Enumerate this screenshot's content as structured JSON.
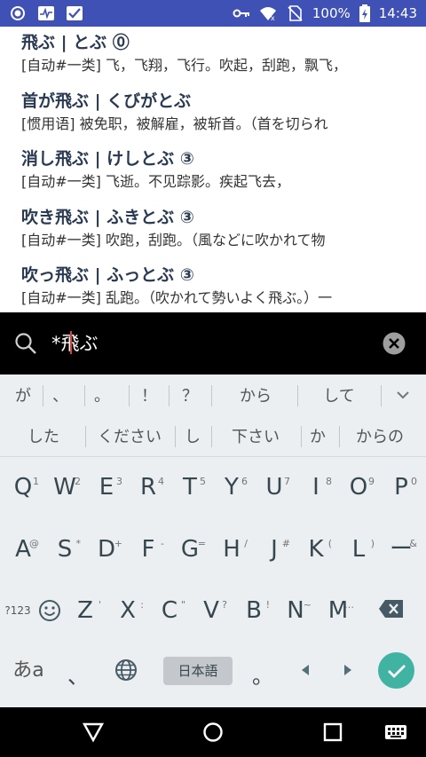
{
  "status_bar": {
    "battery": "100%",
    "time": "14:43",
    "icons": [
      "radio-icon",
      "activity-icon",
      "inbox-icon",
      "key-icon",
      "wifi-icon",
      "no-sim-icon",
      "battery-icon"
    ]
  },
  "entries": [
    {
      "title": "飛ぶ | とぶ ⓪",
      "definition": "[自动#一类] 飞，飞翔，飞行。吹起，刮跑，飘飞，"
    },
    {
      "title": "首が飛ぶ | くびがとぶ",
      "definition": "[惯用语] 被免职，被解雇，被斩首。（首を切られ"
    },
    {
      "title": "消し飛ぶ | けしとぶ ③",
      "definition": "[自动#一类] 飞逝。不见踪影。疾起飞去，"
    },
    {
      "title": "吹き飛ぶ | ふきとぶ ③",
      "definition": "[自动#一类] 吹跑，刮跑。（風などに吹かれて物"
    },
    {
      "title": "吹っ飛ぶ | ふっとぶ ③",
      "definition": "[自动#一类] 乱跑。（吹かれて勢いよく飛ぶ。）一"
    }
  ],
  "search": {
    "prefix": "*",
    "query": "飛ぶ"
  },
  "keyboard": {
    "suggestions_row1": [
      "が",
      "、",
      "。",
      "！",
      "？",
      "から",
      "して"
    ],
    "suggestions_row2": [
      "した",
      "ください",
      "し",
      "下さい",
      "か",
      "からの"
    ],
    "row1": [
      {
        "key": "Q",
        "hint": "1"
      },
      {
        "key": "W",
        "hint": "2"
      },
      {
        "key": "E",
        "hint": "3"
      },
      {
        "key": "R",
        "hint": "4"
      },
      {
        "key": "T",
        "hint": "5"
      },
      {
        "key": "Y",
        "hint": "6"
      },
      {
        "key": "U",
        "hint": "7"
      },
      {
        "key": "I",
        "hint": "8"
      },
      {
        "key": "O",
        "hint": "9"
      },
      {
        "key": "P",
        "hint": "0"
      }
    ],
    "row2": [
      {
        "key": "A",
        "hint": "@"
      },
      {
        "key": "S",
        "hint": "*"
      },
      {
        "key": "D",
        "hint": "+"
      },
      {
        "key": "F",
        "hint": "-"
      },
      {
        "key": "G",
        "hint": "="
      },
      {
        "key": "H",
        "hint": "/"
      },
      {
        "key": "J",
        "hint": "#"
      },
      {
        "key": "K",
        "hint": "("
      },
      {
        "key": "L",
        "hint": ")"
      },
      {
        "key": "ー",
        "hint": "&"
      }
    ],
    "row3": [
      {
        "key": "Z",
        "hint": "'"
      },
      {
        "key": "X",
        "hint": ":"
      },
      {
        "key": "C",
        "hint": "\""
      },
      {
        "key": "V",
        "hint": "?"
      },
      {
        "key": "B",
        "hint": "!"
      },
      {
        "key": "N",
        "hint": "~"
      },
      {
        "key": "M",
        "hint": "…"
      }
    ],
    "sym_label": "?123",
    "lang_key_label": "あa",
    "comma_label": "、",
    "space_label": "日本語",
    "period_label": "。"
  },
  "colors": {
    "status_bar": "#3f51b5",
    "title_text": "#2a3a52",
    "enter_key": "#41b3a3",
    "cursor": "#e53935"
  }
}
